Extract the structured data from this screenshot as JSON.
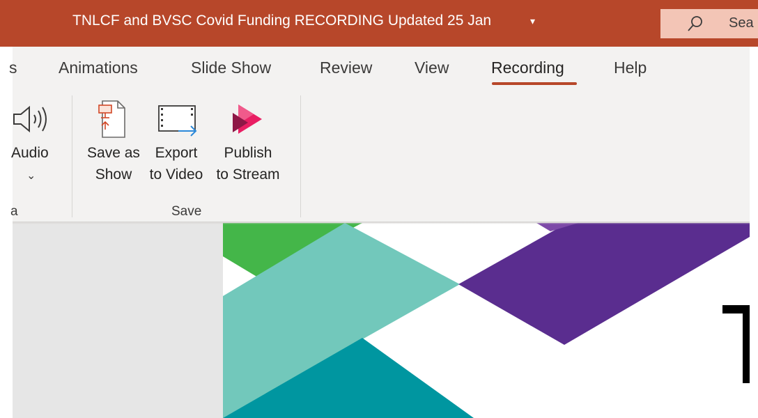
{
  "window": {
    "title": "TNLCF and BVSC Covid Funding RECORDING Updated 25 Jan",
    "title_caret": "▾",
    "search_text": "Sea"
  },
  "tabs": [
    {
      "label": "s"
    },
    {
      "label": "Animations"
    },
    {
      "label": "Slide Show"
    },
    {
      "label": "Review"
    },
    {
      "label": "View"
    },
    {
      "label": "Recording",
      "active": true
    },
    {
      "label": "Help"
    }
  ],
  "ribbon": {
    "audio": {
      "label": "Audio",
      "chevron": "⌄",
      "group_label": "a"
    },
    "save_group": {
      "label": "Save",
      "commands": [
        {
          "line1": "Save as",
          "line2": "Show",
          "icon": "save-as-show-icon"
        },
        {
          "line1": "Export",
          "line2": "to Video",
          "icon": "export-video-icon"
        },
        {
          "line1": "Publish",
          "line2": "to Stream",
          "icon": "stream-icon"
        }
      ]
    }
  },
  "colors": {
    "titlebar": "#b7472a",
    "ribbon": "#f3f2f1",
    "green": "#44b649",
    "teal_light": "#72c8bb",
    "teal_dark": "#0096a0",
    "purple": "#5a2d8f"
  }
}
